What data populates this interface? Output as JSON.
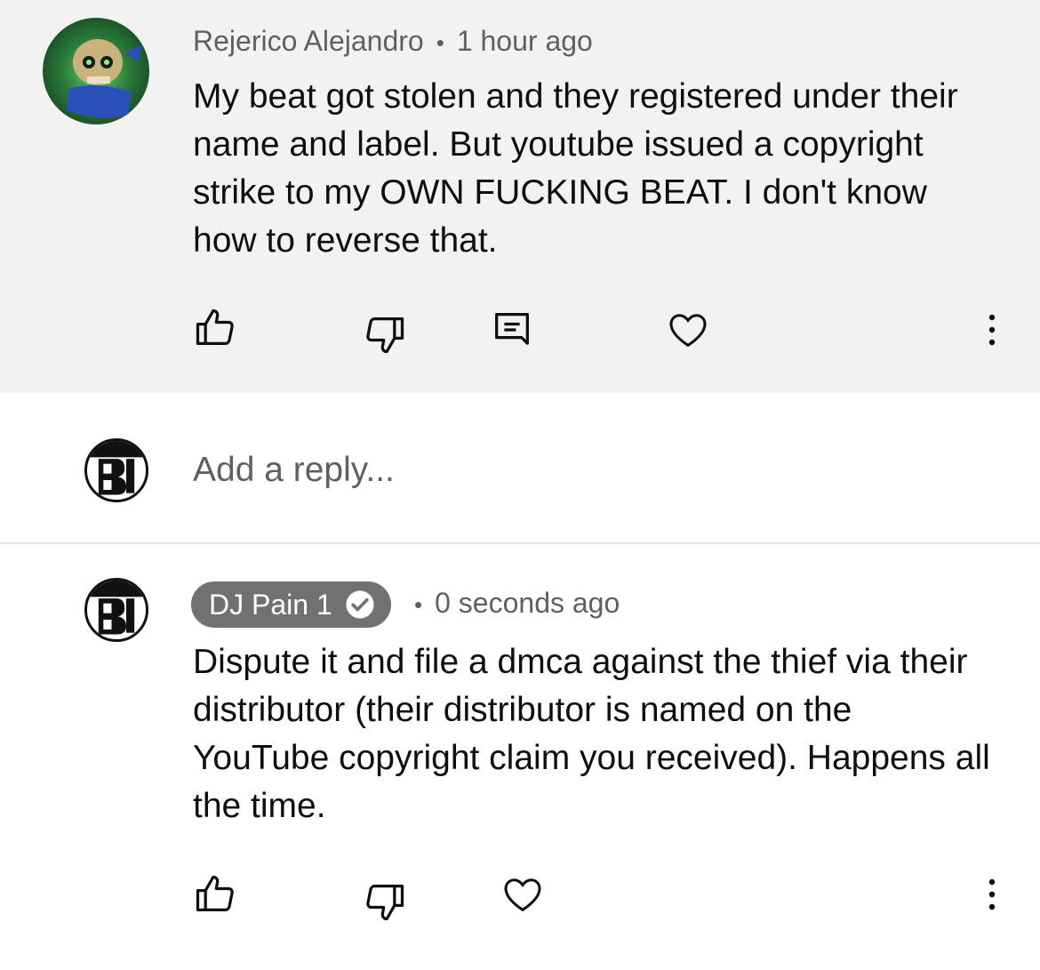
{
  "comment": {
    "author": "Rejerico Alejandro",
    "separator": "•",
    "time": "1 hour ago",
    "text": "My beat got stolen and they registered under their name and label. But youtube issued a copyright strike to my OWN FUCKING BEAT. I don't know how to reverse that.",
    "actions": [
      "thumbs-up-icon",
      "thumbs-down-icon",
      "reply-comment-icon",
      "heart-icon",
      "more-vert-icon"
    ]
  },
  "reply_box": {
    "placeholder": "Add a reply..."
  },
  "reply": {
    "author": "DJ Pain 1",
    "separator": "•",
    "time": "0 seconds ago",
    "text": "Dispute it and file a dmca against the thief via their distributor (their distributor is named on the YouTube copyright claim you received). Happens all the time.",
    "actions": [
      "thumbs-up-icon",
      "thumbs-down-icon",
      "heart-icon",
      "more-vert-icon"
    ]
  },
  "colors": {
    "highlight_bg": "#f2f2f2",
    "meta_text": "#606060",
    "badge_bg": "#717171",
    "divider": "#e5e5e5"
  }
}
